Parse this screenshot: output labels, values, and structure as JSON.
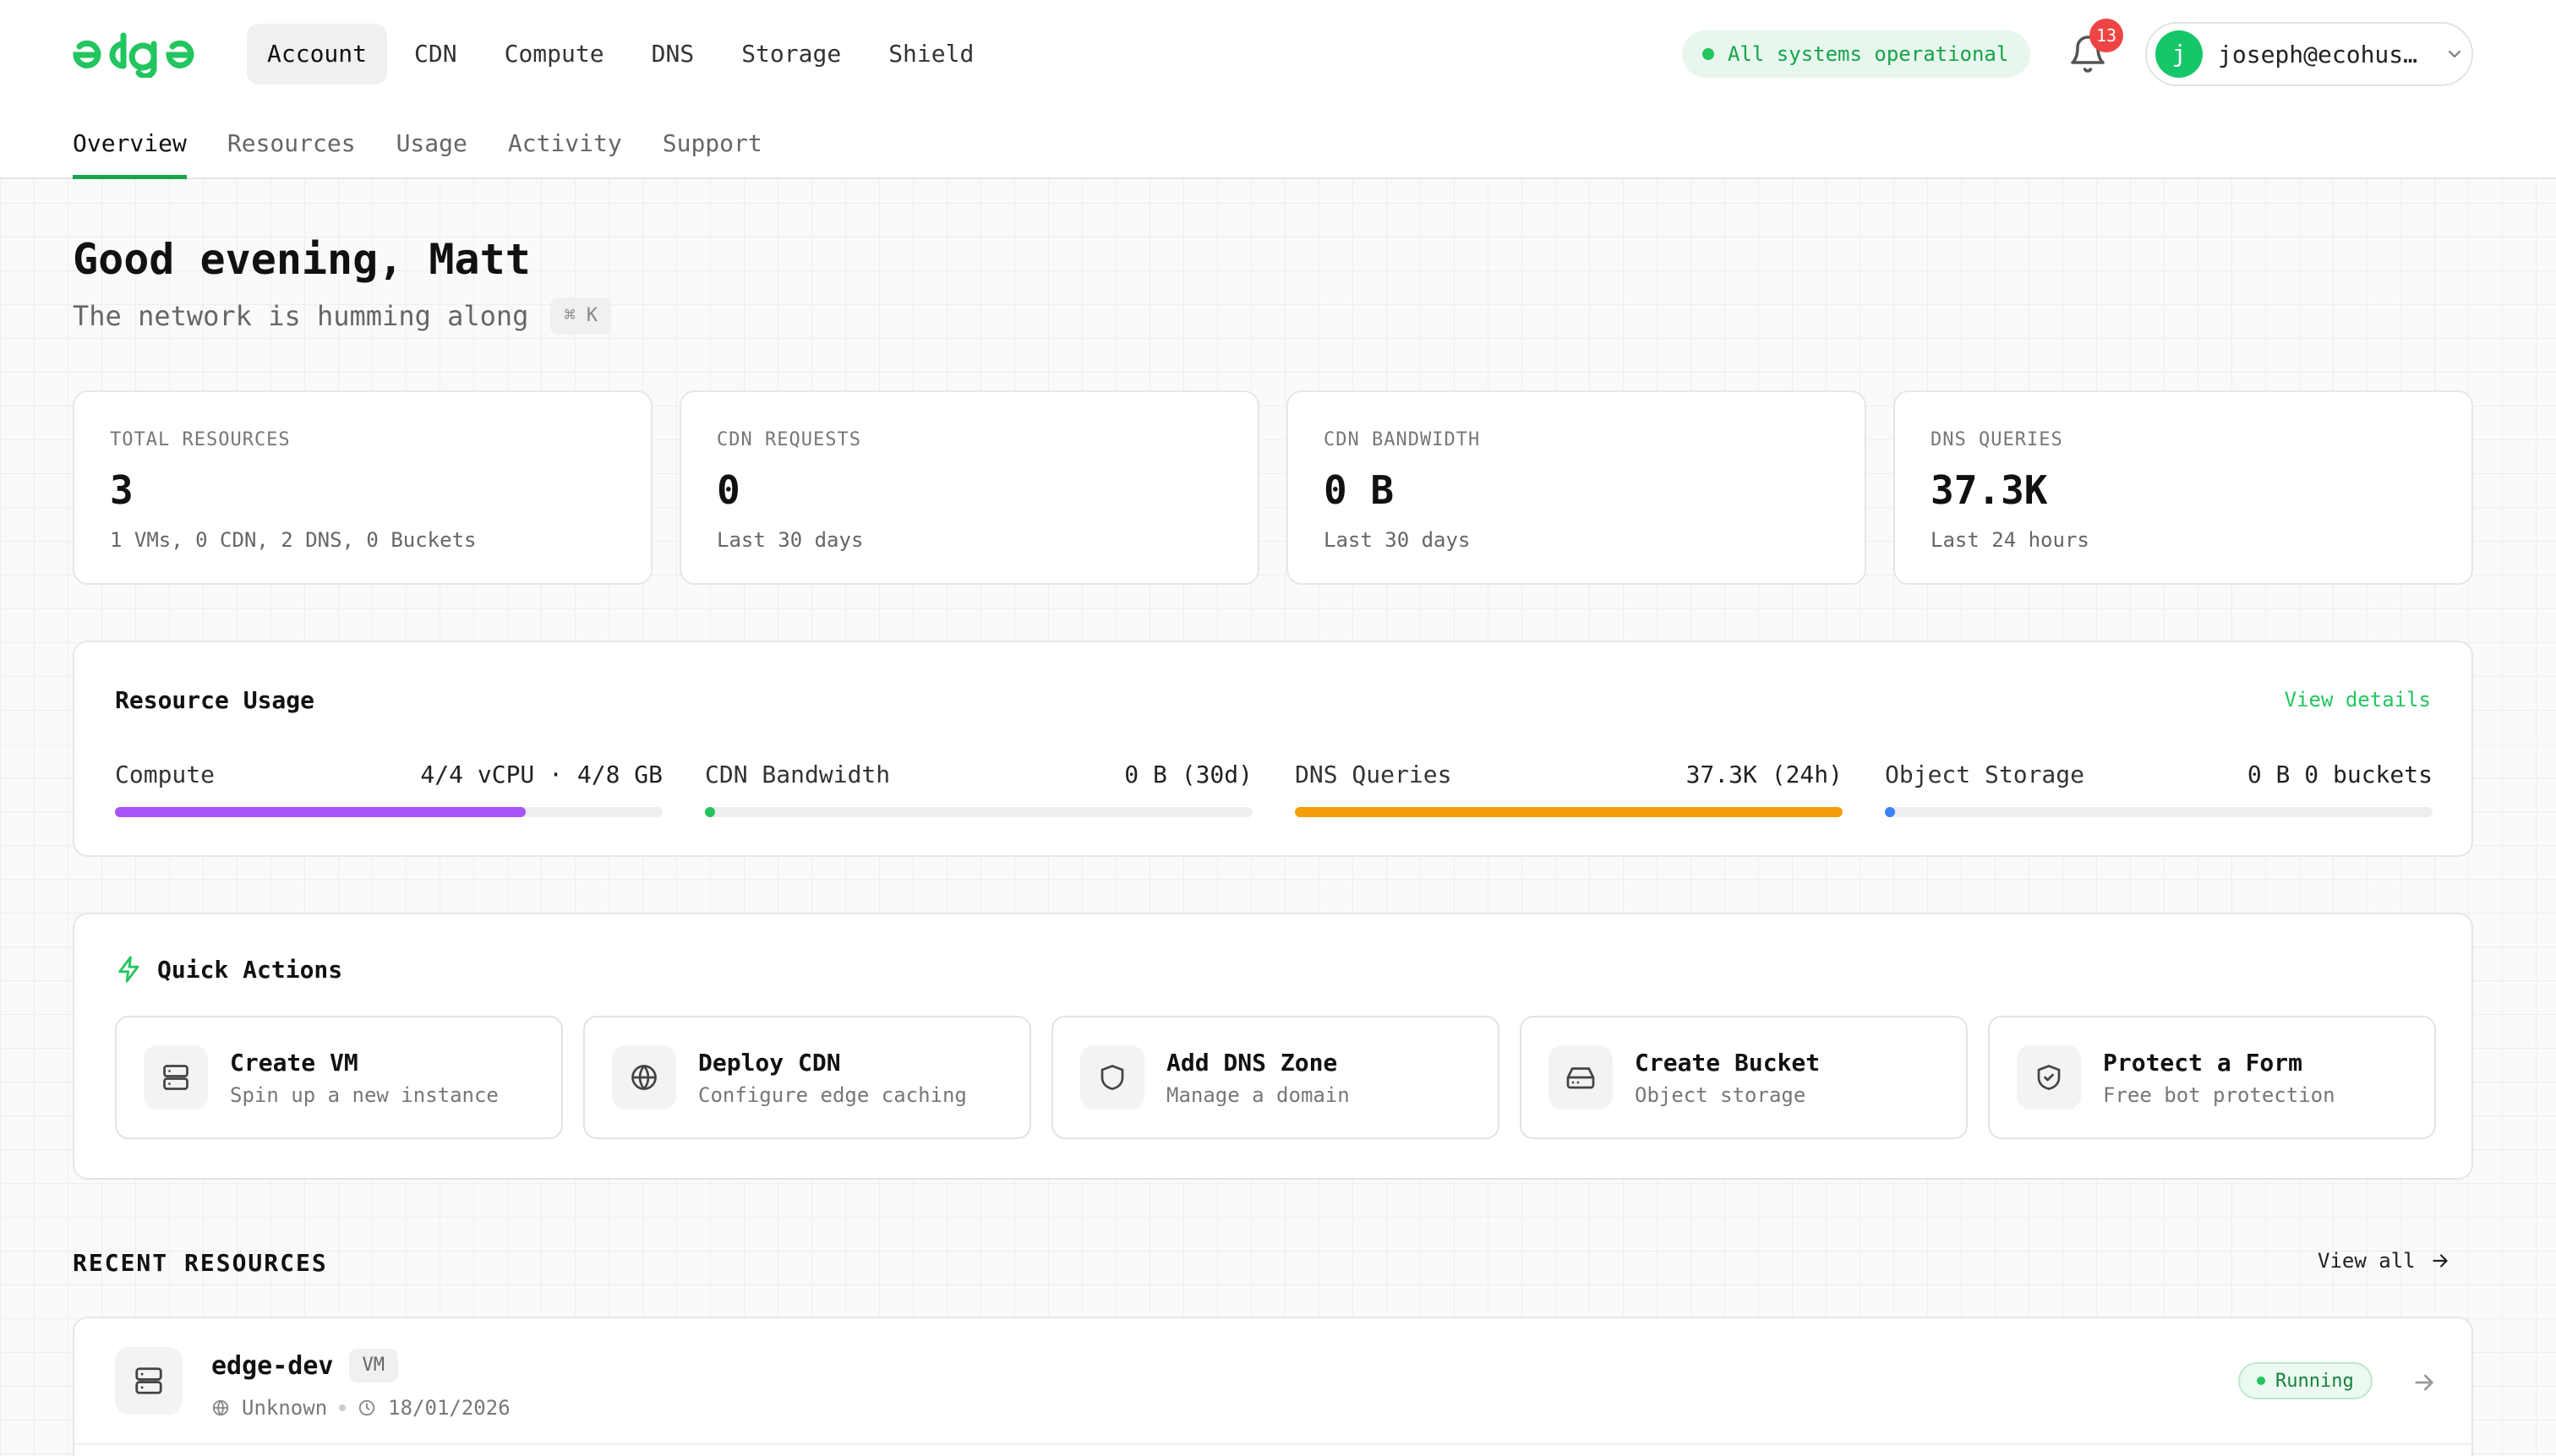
{
  "brand": {
    "logo_text": "edge",
    "accent_color": "#22c55e"
  },
  "nav": {
    "main": [
      "Account",
      "CDN",
      "Compute",
      "DNS",
      "Storage",
      "Shield"
    ],
    "active_main": "Account",
    "sub": [
      "Overview",
      "Resources",
      "Usage",
      "Activity",
      "Support"
    ],
    "active_sub": "Overview"
  },
  "status": {
    "text": "All systems operational",
    "color": "#22c55e"
  },
  "notifications": {
    "count": "13",
    "icon": "bell-icon"
  },
  "user": {
    "avatar_letter": "j",
    "email": "joseph@ecohus…"
  },
  "greeting": {
    "title": "Good evening, Matt",
    "subtitle": "The network is humming along",
    "shortcut": "⌘ K"
  },
  "stats": [
    {
      "label": "TOTAL RESOURCES",
      "value": "3",
      "sub": "1 VMs, 0 CDN, 2 DNS, 0 Buckets"
    },
    {
      "label": "CDN REQUESTS",
      "value": "0",
      "sub": "Last 30 days"
    },
    {
      "label": "CDN BANDWIDTH",
      "value": "0 B",
      "sub": "Last 30 days"
    },
    {
      "label": "DNS QUERIES",
      "value": "37.3K",
      "sub": "Last 24 hours"
    }
  ],
  "usage": {
    "title": "Resource Usage",
    "view_details": "View details",
    "meters": [
      {
        "label": "Compute",
        "value": "4/4 vCPU · 4/8 GB",
        "fill_percent": 75,
        "color": "#a855f7"
      },
      {
        "label": "CDN Bandwidth",
        "value": "0 B (30d)",
        "fill_percent": 0,
        "color": "#22c55e"
      },
      {
        "label": "DNS Queries",
        "value": "37.3K (24h)",
        "fill_percent": 100,
        "color": "#f59e0b"
      },
      {
        "label": "Object Storage",
        "value": "0 B 0 buckets",
        "fill_percent": 0,
        "color": "#3b82f6"
      }
    ]
  },
  "quick_actions": {
    "title": "Quick Actions",
    "items": [
      {
        "name": "Create VM",
        "desc": "Spin up a new instance",
        "icon": "server-icon"
      },
      {
        "name": "Deploy CDN",
        "desc": "Configure edge caching",
        "icon": "globe-icon"
      },
      {
        "name": "Add DNS Zone",
        "desc": "Manage a domain",
        "icon": "shield-icon"
      },
      {
        "name": "Create Bucket",
        "desc": "Object storage",
        "icon": "hard-drive-icon"
      },
      {
        "name": "Protect a Form",
        "desc": "Free bot protection",
        "icon": "shield-check-icon"
      }
    ]
  },
  "recent": {
    "title": "RECENT RESOURCES",
    "view_all": "View all",
    "rows": [
      {
        "name": "edge-dev",
        "type": "VM",
        "location": "Unknown",
        "date": "18/01/2026",
        "status": "Running"
      }
    ]
  }
}
